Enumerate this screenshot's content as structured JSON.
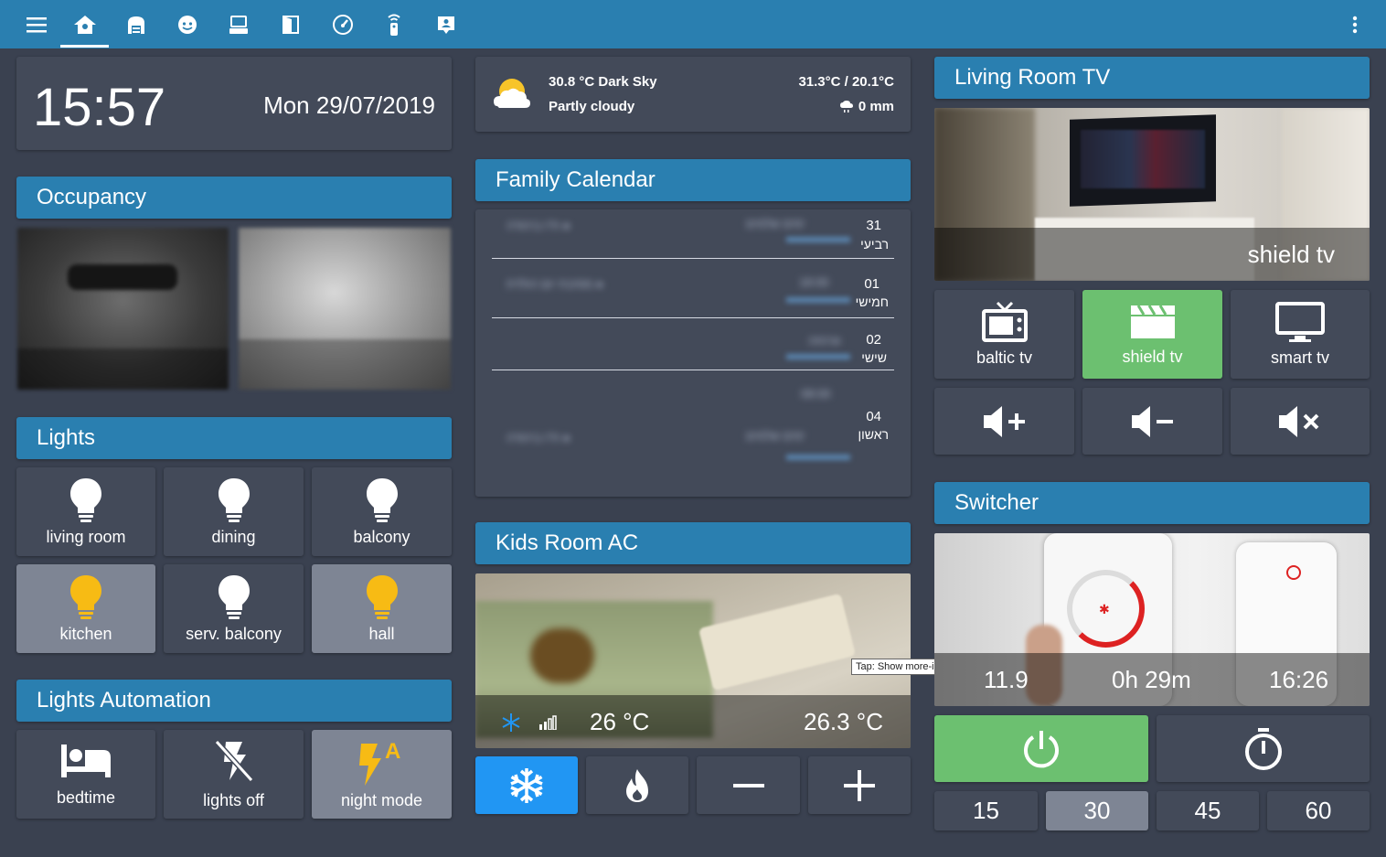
{
  "clock": {
    "time": "15:57",
    "date": "Mon 29/07/2019"
  },
  "weather": {
    "temp_source": "30.8 °C Dark Sky",
    "condition": "Partly cloudy",
    "high_low": "31.3°C / 20.1°C",
    "precip": "0 mm",
    "icon": "partly-cloudy-icon"
  },
  "occupancy": {
    "title": "Occupancy"
  },
  "lights": {
    "title": "Lights",
    "items": [
      {
        "label": "living room",
        "state": "off"
      },
      {
        "label": "dining",
        "state": "off"
      },
      {
        "label": "balcony",
        "state": "off"
      },
      {
        "label": "kitchen",
        "state": "on"
      },
      {
        "label": "serv. balcony",
        "state": "off"
      },
      {
        "label": "hall",
        "state": "on"
      }
    ]
  },
  "automation": {
    "title": "Lights Automation",
    "items": [
      {
        "label": "bedtime",
        "icon": "bed-icon"
      },
      {
        "label": "lights off",
        "icon": "flash-off-icon"
      },
      {
        "label": "night mode",
        "icon": "flash-auto-icon"
      }
    ]
  },
  "calendar": {
    "title": "Family Calendar",
    "days": [
      {
        "num": "31",
        "name": "רביעי"
      },
      {
        "num": "01",
        "name": "חמישי"
      },
      {
        "num": "02",
        "name": "שישי"
      },
      {
        "num": "04",
        "name": "ראשון"
      }
    ]
  },
  "ac": {
    "title": "Kids Room AC",
    "target": "26 °C",
    "current": "26.3 °C",
    "tooltip": "Tap: Show more-info: Kids Room",
    "buttons": [
      "snowflake-icon",
      "fire-icon",
      "minus-icon",
      "plus-icon"
    ]
  },
  "tv": {
    "title": "Living Room TV",
    "source": "shield tv",
    "sources": [
      {
        "label": "baltic tv",
        "icon": "tv-antenna-icon"
      },
      {
        "label": "shield tv",
        "icon": "clapperboard-icon"
      },
      {
        "label": "smart tv",
        "icon": "monitor-icon"
      }
    ],
    "volume": [
      "volume-up-icon",
      "volume-down-icon",
      "volume-mute-icon"
    ]
  },
  "switcher": {
    "title": "Switcher",
    "stats": [
      "11.9",
      "0h 29m",
      "16:26"
    ],
    "timers": [
      "15",
      "30",
      "45",
      "60"
    ],
    "selected_timer": "30"
  },
  "colors": {
    "accent": "#2a7fb0",
    "card": "#434a59",
    "bg": "#3a4150",
    "on_green": "#6cc070",
    "bulb_on": "#f7bb14"
  }
}
